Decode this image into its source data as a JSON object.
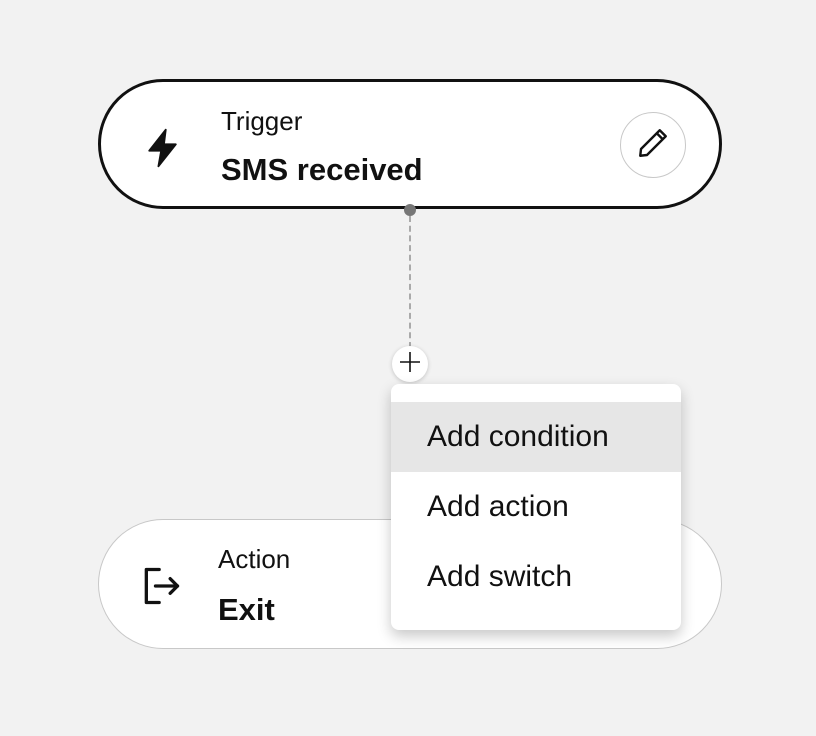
{
  "trigger": {
    "label": "Trigger",
    "title": "SMS received",
    "icon": "lightning-icon",
    "edit_icon": "pencil-icon"
  },
  "action": {
    "label": "Action",
    "title": "Exit",
    "icon": "exit-icon"
  },
  "add_button": {
    "icon": "plus-icon"
  },
  "menu": {
    "items": [
      {
        "label": "Add condition",
        "highlighted": true
      },
      {
        "label": "Add action",
        "highlighted": false
      },
      {
        "label": "Add switch",
        "highlighted": false
      }
    ]
  }
}
